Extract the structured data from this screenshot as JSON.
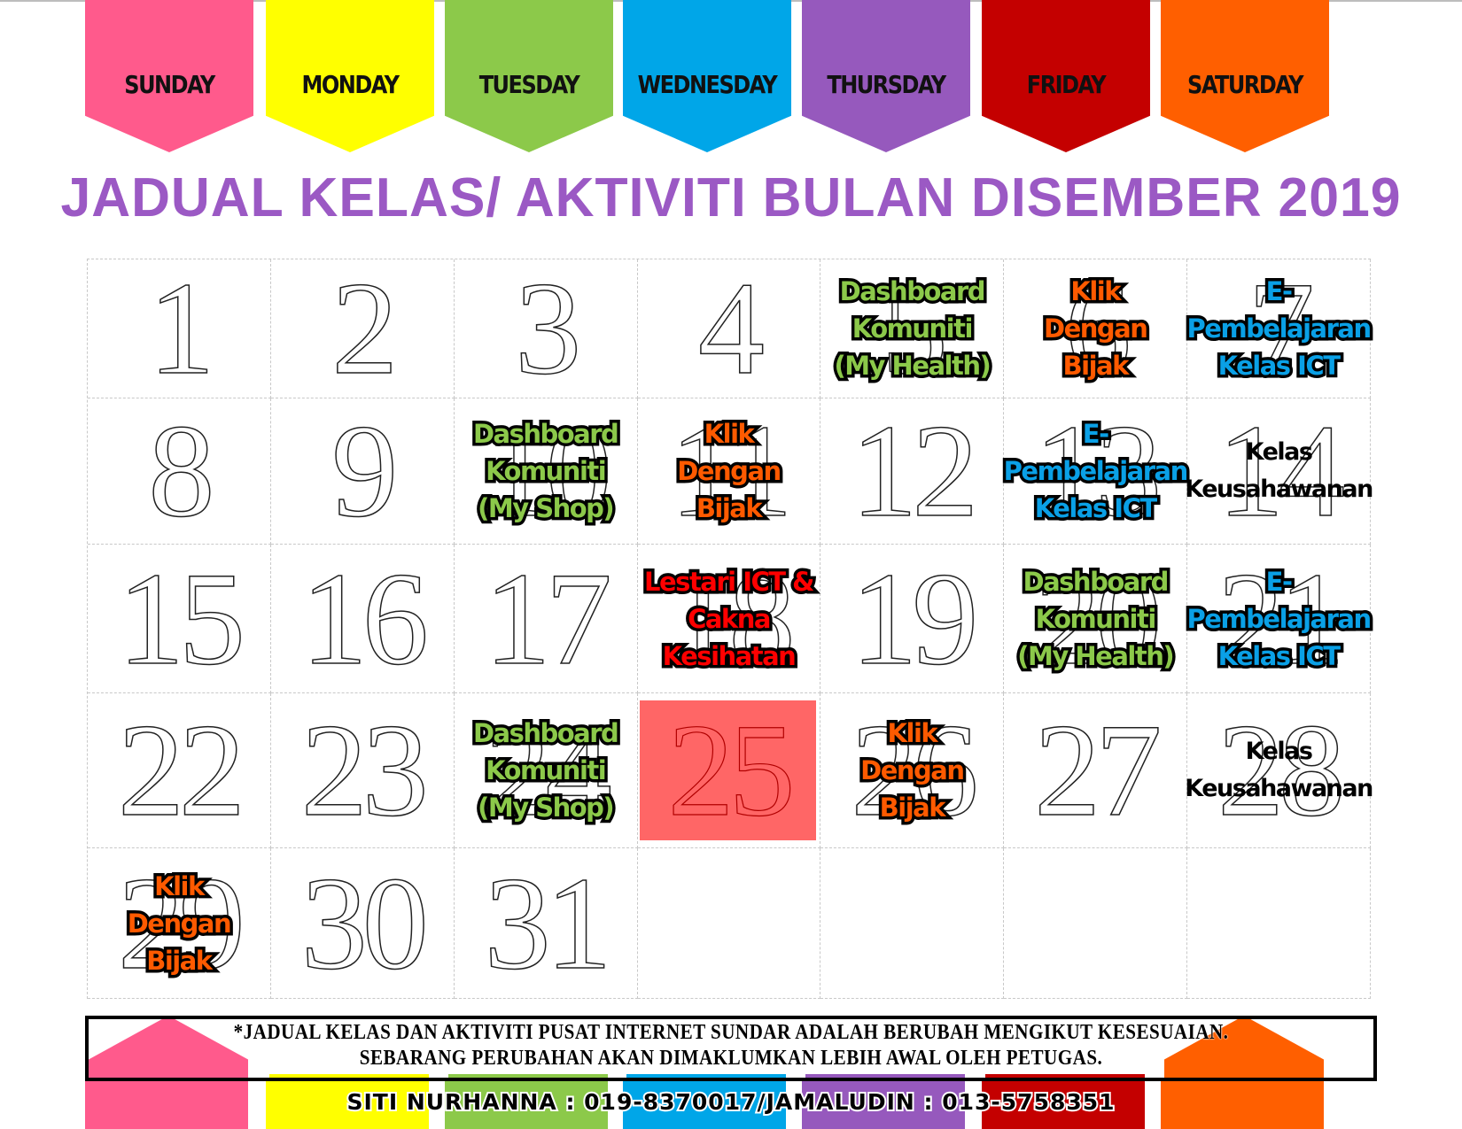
{
  "days": [
    {
      "label": "SUNDAY",
      "color": "#ff5a8c"
    },
    {
      "label": "MONDAY",
      "color": "#ffff00"
    },
    {
      "label": "TUESDAY",
      "color": "#8cc94a"
    },
    {
      "label": "WEDNESDAY",
      "color": "#00a6e8"
    },
    {
      "label": "THURSDAY",
      "color": "#9659bd"
    },
    {
      "label": "FRIDAY",
      "color": "#c40000"
    },
    {
      "label": "SATURDAY",
      "color": "#ff5f00"
    }
  ],
  "title": "JADUAL KELAS/ AKTIVITI BULAN DISEMBER 2019",
  "event_colors": {
    "dashboard": "#8cc94a",
    "klik": "#ff5a00",
    "epembelajaran": "#0aa0e6",
    "lestari": "#ff0000",
    "kelas": "#000000"
  },
  "calendar": [
    {
      "day": "1"
    },
    {
      "day": "2"
    },
    {
      "day": "3"
    },
    {
      "day": "4"
    },
    {
      "day": "5",
      "event": "Dashboard\nKomuniti\n(My Health)",
      "type": "dashboard"
    },
    {
      "day": "6",
      "event": "Klik\nDengan\nBijak",
      "type": "klik"
    },
    {
      "day": "7",
      "event": "E-Pembelajaran\nKelas ICT",
      "type": "epembelajaran"
    },
    {
      "day": "8"
    },
    {
      "day": "9"
    },
    {
      "day": "10",
      "event": "Dashboard\nKomuniti\n(My Shop)",
      "type": "dashboard"
    },
    {
      "day": "11",
      "event": "Klik\nDengan\nBijak",
      "type": "klik"
    },
    {
      "day": "12"
    },
    {
      "day": "13",
      "event": "E-Pembelajaran\nKelas ICT",
      "type": "epembelajaran"
    },
    {
      "day": "14",
      "event": "Kelas\nKeusahawanan",
      "type": "kelas"
    },
    {
      "day": "15"
    },
    {
      "day": "16"
    },
    {
      "day": "17"
    },
    {
      "day": "18",
      "event": "Lestari ICT &\nCakna\nKesihatan",
      "type": "lestari"
    },
    {
      "day": "19"
    },
    {
      "day": "20",
      "event": "Dashboard\nKomuniti\n(My Health)",
      "type": "dashboard"
    },
    {
      "day": "21",
      "event": "E-Pembelajaran\nKelas ICT",
      "type": "epembelajaran"
    },
    {
      "day": "22"
    },
    {
      "day": "23"
    },
    {
      "day": "24",
      "event": "Dashboard\nKomuniti\n(My Shop)",
      "type": "dashboard"
    },
    {
      "day": "25",
      "highlight": true,
      "highlight_color": "#ff6666"
    },
    {
      "day": "26",
      "event": "Klik\nDengan\nBijak",
      "type": "klik"
    },
    {
      "day": "27"
    },
    {
      "day": "28",
      "event": "Kelas\nKeusahawanan",
      "type": "kelas"
    },
    {
      "day": "29",
      "event": "Klik\nDengan\nBijak",
      "type": "klik"
    },
    {
      "day": "30"
    },
    {
      "day": "31"
    },
    {
      "day": ""
    },
    {
      "day": ""
    },
    {
      "day": ""
    },
    {
      "day": ""
    }
  ],
  "note": {
    "line1": "*JADUAL KELAS DAN AKTIVITI PUSAT INTERNET SUNDAR ADALAH BERUBAH MENGIKUT KESESUAIAN.",
    "line2": "SEBARANG PERUBAHAN AKAN DIMAKLUMKAN LEBIH AWAL OLEH PETUGAS."
  },
  "contact": "SITI NURHANNA : 019-8370017/JAMALUDIN : 013-5758351"
}
